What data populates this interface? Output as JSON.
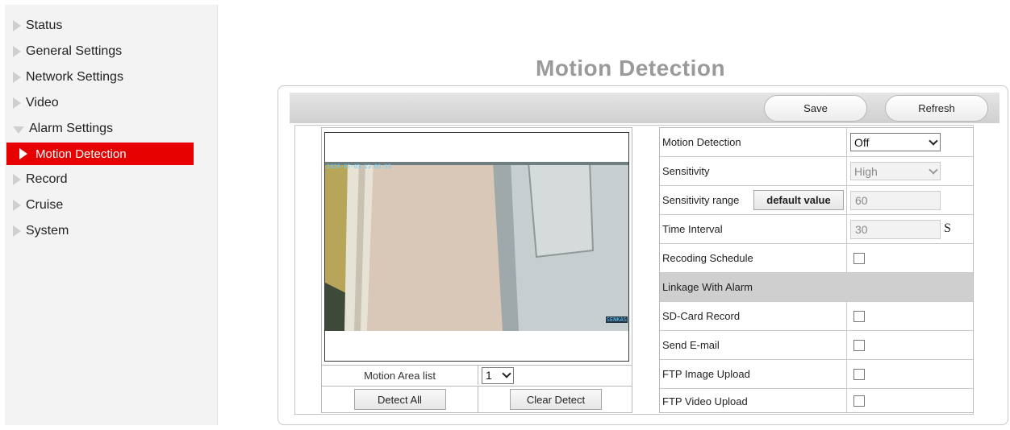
{
  "sidebar": {
    "items": [
      {
        "label": "Status",
        "expanded": false,
        "active": false
      },
      {
        "label": "General Settings",
        "expanded": false,
        "active": false
      },
      {
        "label": "Network Settings",
        "expanded": false,
        "active": false
      },
      {
        "label": "Video",
        "expanded": false,
        "active": false
      },
      {
        "label": "Alarm Settings",
        "expanded": true,
        "active": false
      },
      {
        "label": "Motion Detection",
        "expanded": false,
        "active": true
      },
      {
        "label": "Record",
        "expanded": false,
        "active": false
      },
      {
        "label": "Cruise",
        "expanded": false,
        "active": false
      },
      {
        "label": "System",
        "expanded": false,
        "active": false
      }
    ]
  },
  "page": {
    "title": "Motion Detection"
  },
  "toolbar": {
    "save_label": "Save",
    "refresh_label": "Refresh"
  },
  "preview": {
    "osd_timestamp": "2020-07-03 13:05:55",
    "osd_label": "SENKAS",
    "area_list_label": "Motion Area list",
    "area_list_value": "1",
    "detect_all_label": "Detect All",
    "clear_detect_label": "Clear Detect"
  },
  "settings": {
    "motion_detection": {
      "label": "Motion Detection",
      "value": "Off"
    },
    "sensitivity": {
      "label": "Sensitivity",
      "value": "High"
    },
    "sensitivity_range": {
      "label": "Sensitivity range",
      "button": "default value",
      "value": "60"
    },
    "time_interval": {
      "label": "Time Interval",
      "value": "30",
      "unit": "S"
    },
    "recording_schedule": {
      "label": "Recoding Schedule",
      "checked": false
    },
    "linkage_header": "Linkage With Alarm",
    "sd_card_record": {
      "label": "SD-Card Record",
      "checked": false
    },
    "send_email": {
      "label": "Send E-mail",
      "checked": false
    },
    "ftp_image_upload": {
      "label": "FTP Image Upload",
      "checked": false
    },
    "ftp_video_upload": {
      "label": "FTP Video Upload",
      "checked": false
    }
  },
  "colors": {
    "active_nav": "#e60000",
    "title_gray": "#9a9a9a",
    "section_bg": "#cfcfcf"
  }
}
